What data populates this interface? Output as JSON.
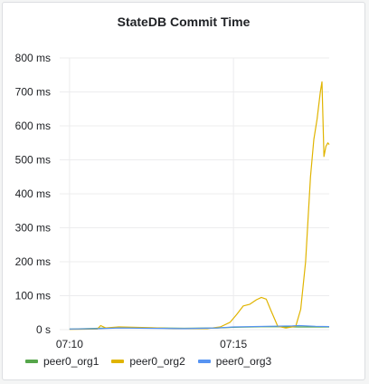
{
  "panel": {
    "title": "StateDB Commit Time"
  },
  "chart_data": {
    "type": "line",
    "title": "StateDB Commit Time",
    "xlabel": "",
    "ylabel": "",
    "x_unit": "minutes",
    "xlim": [
      69.7,
      77.92
    ],
    "ylim": [
      0,
      800
    ],
    "y_ticks": [
      0,
      100,
      200,
      300,
      400,
      500,
      600,
      700,
      800
    ],
    "y_tick_labels": [
      "0 s",
      "100 ms",
      "200 ms",
      "300 ms",
      "400 ms",
      "500 ms",
      "600 ms",
      "700 ms",
      "800 ms"
    ],
    "x_ticks": [
      70,
      75
    ],
    "x_tick_labels": [
      "07:10",
      "07:15"
    ],
    "grid": true,
    "legend_position": "bottom-left",
    "series": [
      {
        "name": "peer0_org1",
        "color": "#56a64b",
        "points": [
          [
            70.0,
            2
          ],
          [
            70.9,
            4
          ],
          [
            71.5,
            6
          ],
          [
            72.5,
            5
          ],
          [
            73.5,
            4
          ],
          [
            74.5,
            5
          ],
          [
            75.0,
            7
          ],
          [
            76.0,
            9
          ],
          [
            77.0,
            8
          ],
          [
            77.92,
            8
          ]
        ]
      },
      {
        "name": "peer0_org2",
        "color": "#e0b400",
        "points": [
          [
            70.0,
            1
          ],
          [
            70.85,
            2
          ],
          [
            70.95,
            12
          ],
          [
            71.1,
            5
          ],
          [
            71.5,
            8
          ],
          [
            72.5,
            6
          ],
          [
            73.2,
            3
          ],
          [
            74.2,
            3
          ],
          [
            74.6,
            8
          ],
          [
            74.9,
            22
          ],
          [
            75.1,
            45
          ],
          [
            75.3,
            70
          ],
          [
            75.5,
            75
          ],
          [
            75.7,
            88
          ],
          [
            75.85,
            95
          ],
          [
            76.0,
            90
          ],
          [
            76.15,
            55
          ],
          [
            76.35,
            10
          ],
          [
            76.6,
            5
          ],
          [
            76.9,
            10
          ],
          [
            77.05,
            60
          ],
          [
            77.2,
            200
          ],
          [
            77.35,
            450
          ],
          [
            77.45,
            560
          ],
          [
            77.55,
            620
          ],
          [
            77.65,
            700
          ],
          [
            77.7,
            730
          ],
          [
            77.73,
            620
          ],
          [
            77.76,
            510
          ],
          [
            77.82,
            540
          ],
          [
            77.88,
            550
          ],
          [
            77.92,
            545
          ]
        ]
      },
      {
        "name": "peer0_org3",
        "color": "#5794f2",
        "points": [
          [
            70.0,
            2
          ],
          [
            70.9,
            3
          ],
          [
            71.5,
            5
          ],
          [
            72.5,
            4
          ],
          [
            73.5,
            3
          ],
          [
            74.5,
            5
          ],
          [
            75.0,
            8
          ],
          [
            76.0,
            10
          ],
          [
            76.8,
            11
          ],
          [
            77.0,
            12
          ],
          [
            77.5,
            10
          ],
          [
            77.92,
            9
          ]
        ]
      }
    ]
  }
}
